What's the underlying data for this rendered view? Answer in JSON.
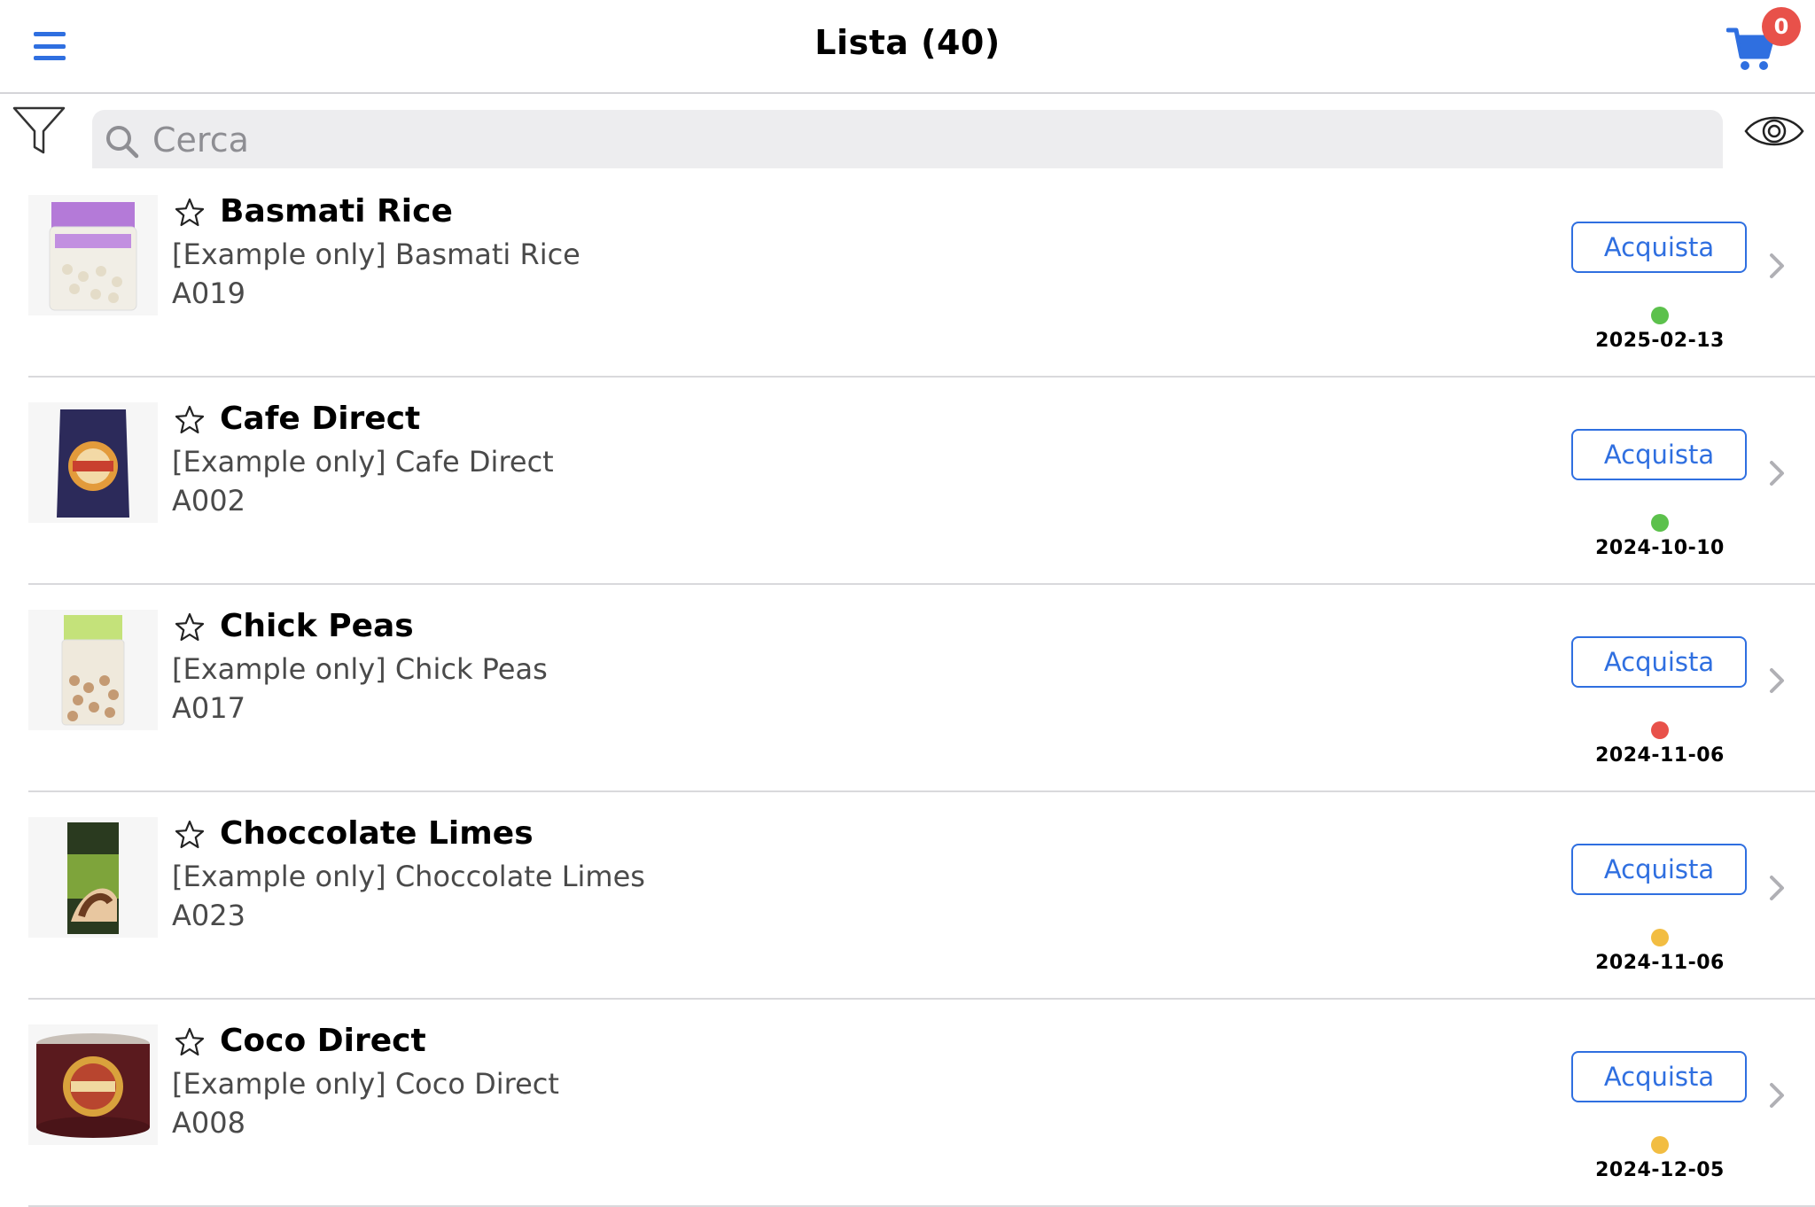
{
  "header": {
    "title": "Lista (40)",
    "cart_count": "0"
  },
  "search": {
    "placeholder": "Cerca"
  },
  "colors": {
    "accent": "#2f6fe0",
    "badge": "#e8514a",
    "status_green": "#5cc14c",
    "status_red": "#e8514a",
    "status_yellow": "#f2bd42"
  },
  "icons": {
    "menu": "hamburger-icon",
    "cart": "cart-icon",
    "filter": "filter-icon",
    "search": "search-icon",
    "view": "eye-icon",
    "favorite": "star-outline-icon",
    "disclosure": "chevron-right-icon"
  },
  "products": [
    {
      "name": "Basmati Rice",
      "description": "[Example only] Basmati Rice",
      "code": "A019",
      "button": "Acquista",
      "status": "green",
      "date": "2025-02-13",
      "image": "rice-bag"
    },
    {
      "name": "Cafe Direct",
      "description": "[Example only] Cafe Direct",
      "code": "A002",
      "button": "Acquista",
      "status": "green",
      "date": "2024-10-10",
      "image": "coffee-bag"
    },
    {
      "name": "Chick Peas",
      "description": "[Example only] Chick Peas",
      "code": "A017",
      "button": "Acquista",
      "status": "red",
      "date": "2024-11-06",
      "image": "chickpea-bag"
    },
    {
      "name": "Choccolate Limes",
      "description": "[Example only] Choccolate Limes",
      "code": "A023",
      "button": "Acquista",
      "status": "yellow",
      "date": "2024-11-06",
      "image": "chocolate-box"
    },
    {
      "name": "Coco Direct",
      "description": "[Example only] Coco Direct",
      "code": "A008",
      "button": "Acquista",
      "status": "yellow",
      "date": "2024-12-05",
      "image": "cocoa-tin"
    }
  ]
}
